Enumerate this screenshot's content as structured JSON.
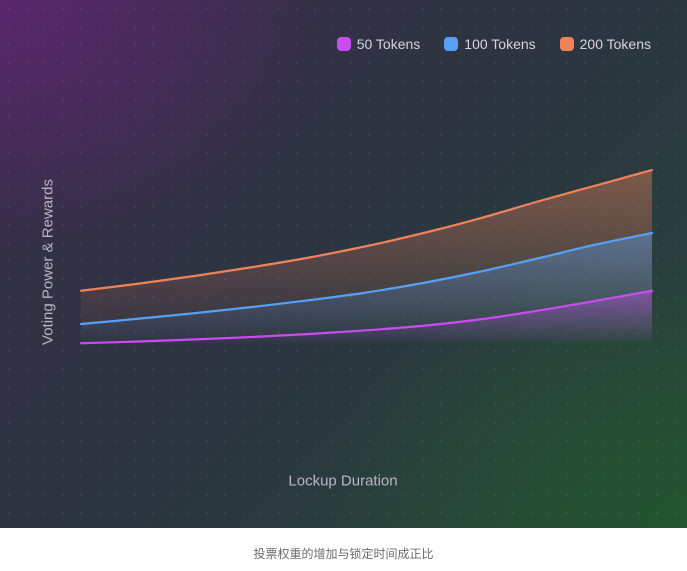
{
  "chart_data": {
    "type": "area",
    "title": "",
    "xlabel": "Lockup Duration",
    "ylabel": "Voting Power & Rewards",
    "x": [
      0,
      1,
      2,
      3,
      4,
      5,
      6,
      7,
      8,
      9,
      10
    ],
    "xlim": [
      0,
      10
    ],
    "ylim": [
      0,
      100
    ],
    "grid": false,
    "legend_position": "top-right",
    "series": [
      {
        "name": "50 Tokens",
        "color": "#c84cf0",
        "values": [
          1.0,
          2.0,
          3.2,
          4.6,
          6.3,
          8.4,
          11.0,
          14.7,
          19.6,
          25.2,
          31.0
        ]
      },
      {
        "name": "100 Tokens",
        "color": "#57a0f5",
        "values": [
          12.0,
          15.0,
          18.2,
          21.7,
          25.6,
          30.0,
          35.5,
          42.0,
          49.5,
          57.3,
          64.0
        ]
      },
      {
        "name": "200 Tokens",
        "color": "#f0825a",
        "values": [
          31.0,
          35.0,
          39.5,
          44.5,
          50.0,
          56.5,
          64.0,
          72.5,
          82.0,
          91.0,
          100.0
        ]
      }
    ]
  },
  "caption": "投票权重的增加与锁定时间成正比"
}
